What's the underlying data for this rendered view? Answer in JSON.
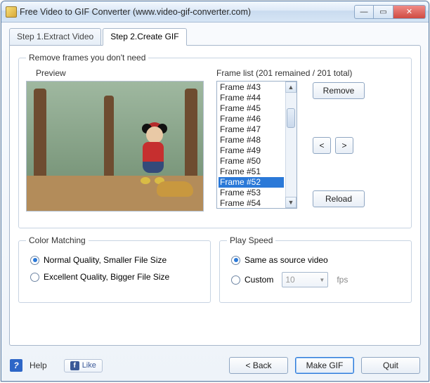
{
  "window": {
    "title": "Free Video to GIF Converter (www.video-gif-converter.com)"
  },
  "tabs": {
    "step1": "Step 1.Extract Video",
    "step2": "Step 2.Create GIF"
  },
  "frames_section": {
    "legend": "Remove frames you don't need",
    "preview_label": "Preview",
    "list_label": "Frame list (201 remained / 201 total)",
    "remove": "Remove",
    "prev": "<",
    "next": ">",
    "reload": "Reload",
    "items": [
      "Frame #43",
      "Frame #44",
      "Frame #45",
      "Frame #46",
      "Frame #47",
      "Frame #48",
      "Frame #49",
      "Frame #50",
      "Frame #51",
      "Frame #52",
      "Frame #53",
      "Frame #54"
    ],
    "selected_index": 9
  },
  "color_matching": {
    "legend": "Color Matching",
    "option_normal": "Normal Quality, Smaller File Size",
    "option_excellent": "Excellent Quality, Bigger File Size",
    "selected": "normal"
  },
  "play_speed": {
    "legend": "Play Speed",
    "option_same": "Same as source video",
    "option_custom": "Custom",
    "custom_value": "10",
    "fps_suffix": "fps",
    "selected": "same"
  },
  "footer": {
    "help": "Help",
    "like": "Like",
    "back": "< Back",
    "make_gif": "Make GIF",
    "quit": "Quit"
  }
}
